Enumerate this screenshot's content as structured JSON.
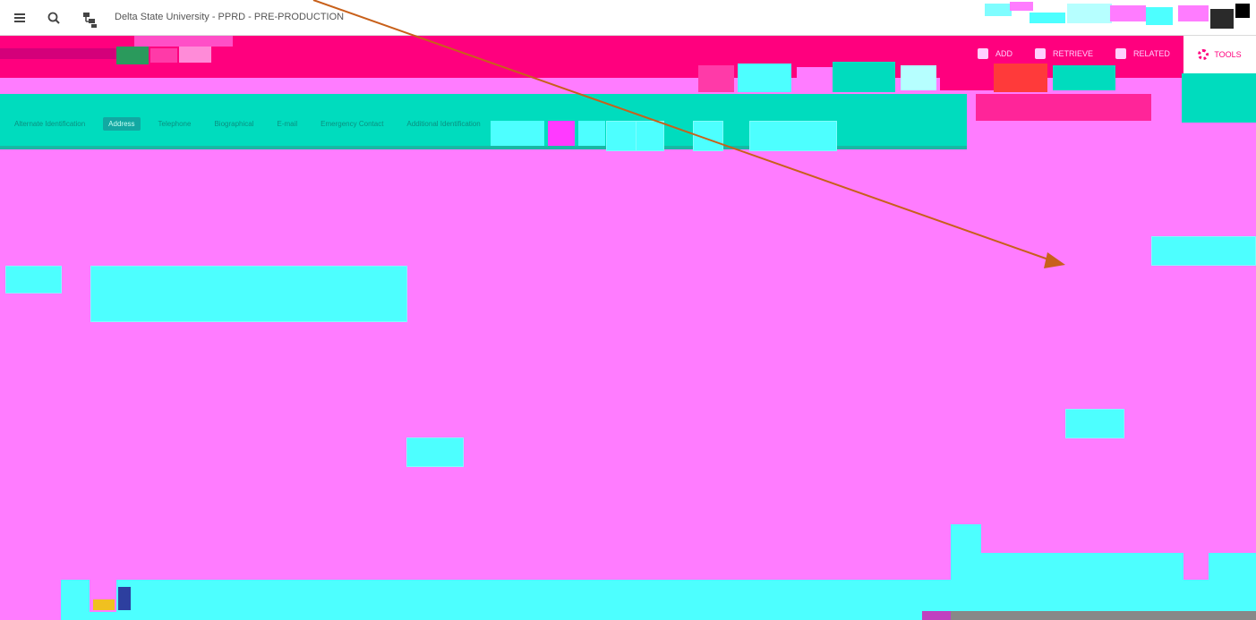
{
  "window": {
    "institution_title": "Delta State University - PPRD - PRE-PRODUCTION"
  },
  "header": {
    "add_label": "ADD",
    "retrieve_label": "RETRIEVE",
    "related_label": "RELATED",
    "tools_label": "TOOLS"
  },
  "colors": {
    "header_pink": "#ff007e",
    "body_magenta": "#ff7cff",
    "tab_cyan": "#00dcbe",
    "box_cyan": "#4dffff",
    "annotation_arrow": "#c8601a"
  },
  "tabs": [
    {
      "label": "Alternate Identification",
      "active": false
    },
    {
      "label": "Address",
      "active": true
    },
    {
      "label": "Telephone",
      "active": false
    },
    {
      "label": "Biographical",
      "active": false
    },
    {
      "label": "E-mail",
      "active": false
    },
    {
      "label": "Emergency Contact",
      "active": false
    },
    {
      "label": "Additional Identification",
      "active": false
    }
  ],
  "icons": {
    "menu": "menu-icon",
    "search": "search-icon",
    "sitemap": "sitemap-icon",
    "gear": "gear-icon"
  }
}
